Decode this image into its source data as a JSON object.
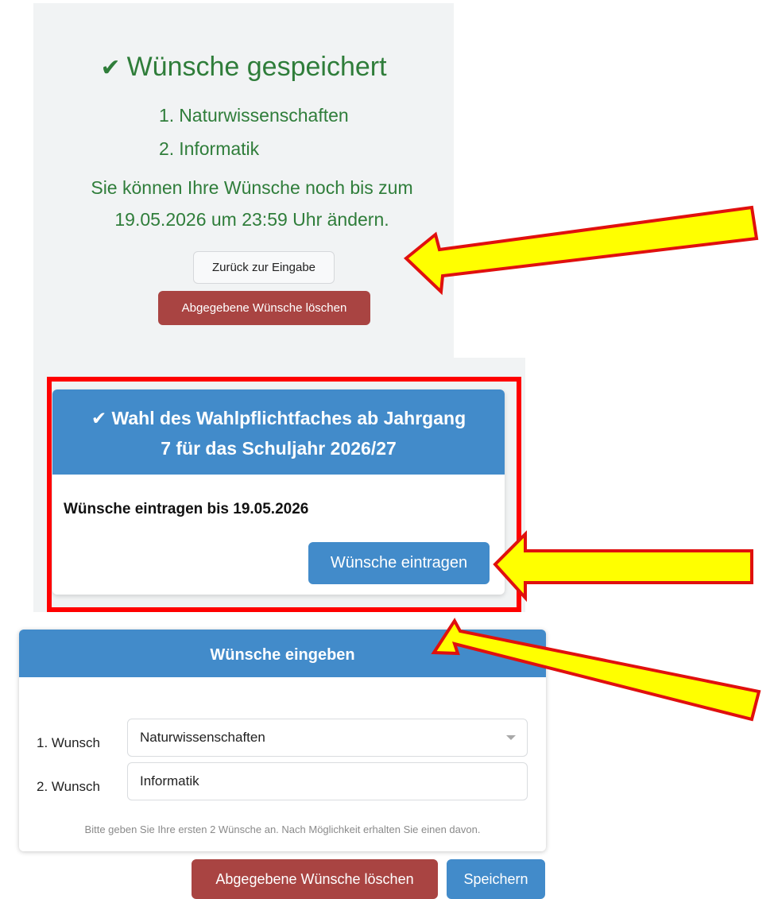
{
  "saved": {
    "title": "Wünsche gespeichert",
    "check_icon": "check-icon",
    "wishes": [
      {
        "num": "1.",
        "label": "Naturwissenschaften"
      },
      {
        "num": "2.",
        "label": "Informatik"
      }
    ],
    "note_line1": "Sie können Ihre Wünsche noch bis zum",
    "note_line2": "19.05.2026 um 23:59 Uhr ändern.",
    "back_button": "Zurück zur Eingabe",
    "delete_button": "Abgegebene Wünsche löschen"
  },
  "election_card": {
    "title_line1": "✔ Wahl des Wahlpflichtfaches ab Jahrgang",
    "title_line2": "7 für das Schuljahr 2026/27",
    "deadline": "Wünsche eintragen bis 19.05.2026",
    "enter_button": "Wünsche eintragen"
  },
  "form": {
    "title": "Wünsche eingeben",
    "rows": [
      {
        "label": "1. Wunsch",
        "value": "Naturwissenschaften"
      },
      {
        "label": "2. Wunsch",
        "value": "Informatik"
      }
    ],
    "hint": "Bitte geben Sie Ihre ersten 2 Wünsche an. Nach Möglichkeit erhalten Sie einen davon.",
    "delete_button": "Abgegebene Wünsche löschen",
    "save_button": "Speichern"
  },
  "colors": {
    "success_green": "#2f7d3a",
    "primary_blue": "#428bca",
    "danger_red": "#a94442",
    "highlight_frame": "#ff0000",
    "arrow_fill": "#ffff00"
  }
}
